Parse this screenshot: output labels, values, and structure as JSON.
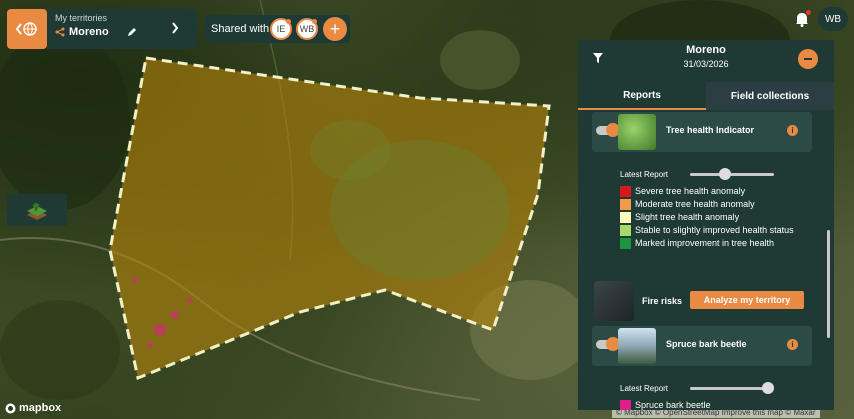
{
  "header": {
    "territories_label": "My territories",
    "territory_name": "Moreno",
    "shared_label": "Shared with",
    "shared_users": [
      "IE",
      "WB"
    ]
  },
  "user": {
    "initials": "WB"
  },
  "panel": {
    "title": "Moreno",
    "date": "31/03/2026",
    "tabs": [
      {
        "label": "Reports",
        "active": true
      },
      {
        "label": "Field collections",
        "active": false
      }
    ],
    "layers": [
      {
        "label": "Tree health Indicator",
        "enabled": true,
        "latest_report_label": "Latest Report",
        "slider_fraction": 0.4,
        "legend": [
          {
            "label": "Severe tree health anomaly",
            "color": "#d7191c"
          },
          {
            "label": "Moderate tree health anomaly",
            "color": "#f39b4b"
          },
          {
            "label": "Slight tree health anomaly",
            "color": "#fefdbd"
          },
          {
            "label": "Stable to slightly improved health status",
            "color": "#a6d96a"
          },
          {
            "label": "Marked improvement in tree health",
            "color": "#1a9641"
          }
        ]
      },
      {
        "label": "Spruce bark beetle",
        "enabled": true,
        "latest_report_label": "Latest Report",
        "slider_fraction": 1.0,
        "legend": [
          {
            "label": "Spruce bark beetle",
            "color": "#e01f8a"
          }
        ]
      }
    ],
    "fire": {
      "label": "Fire risks",
      "button_label": "Analyze my territory"
    }
  },
  "map": {
    "logo": "mapbox",
    "attribution": "© Mapbox © OpenStreetMap Improve this map © Maxar"
  },
  "colors": {
    "accent": "#e98a43",
    "panel": "#1f3a35"
  }
}
